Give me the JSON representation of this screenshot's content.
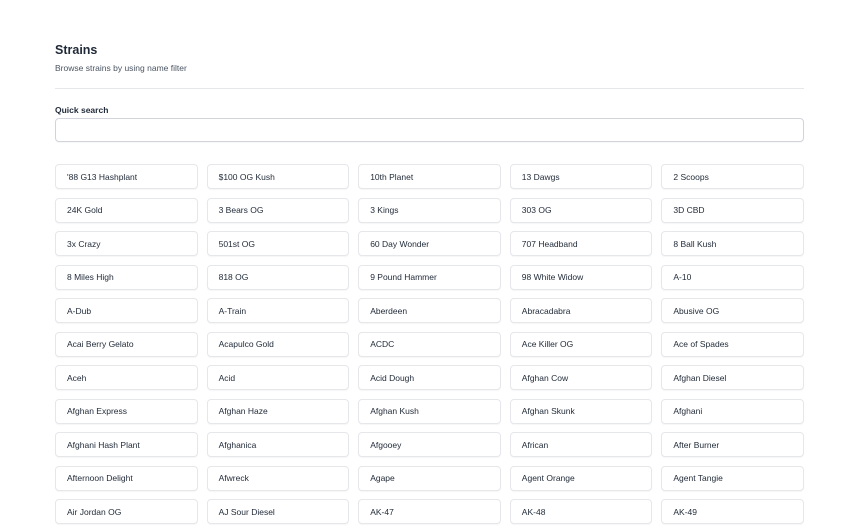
{
  "header": {
    "title": "Strains",
    "subtitle": "Browse strains by using name filter"
  },
  "search": {
    "label": "Quick search",
    "value": "",
    "placeholder": ""
  },
  "strains": [
    "'88 G13 Hashplant",
    "$100 OG Kush",
    "10th Planet",
    "13 Dawgs",
    "2 Scoops",
    "24K Gold",
    "3 Bears OG",
    "3 Kings",
    "303 OG",
    "3D CBD",
    "3x Crazy",
    "501st OG",
    "60 Day Wonder",
    "707 Headband",
    "8 Ball Kush",
    "8 Miles High",
    "818 OG",
    "9 Pound Hammer",
    "98 White Widow",
    "A-10",
    "A-Dub",
    "A-Train",
    "Aberdeen",
    "Abracadabra",
    "Abusive OG",
    "Acai Berry Gelato",
    "Acapulco Gold",
    "ACDC",
    "Ace Killer OG",
    "Ace of Spades",
    "Aceh",
    "Acid",
    "Acid Dough",
    "Afghan Cow",
    "Afghan Diesel",
    "Afghan Express",
    "Afghan Haze",
    "Afghan Kush",
    "Afghan Skunk",
    "Afghani",
    "Afghani Hash Plant",
    "Afghanica",
    "Afgooey",
    "African",
    "After Burner",
    "Afternoon Delight",
    "Afwreck",
    "Agape",
    "Agent Orange",
    "Agent Tangie",
    "Air Jordan OG",
    "AJ Sour Diesel",
    "AK-47",
    "AK-48",
    "AK-49"
  ]
}
